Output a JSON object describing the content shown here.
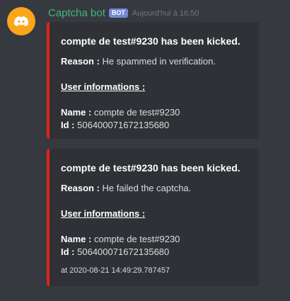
{
  "message": {
    "username": "Captcha bot",
    "bot_tag": "BOT",
    "timestamp": "Aujourd'hui à 16:50",
    "avatar_icon": "discord-logo-icon",
    "colors": {
      "username": "#43b581",
      "bot_tag": "#7289da",
      "avatar": "#faa61a",
      "embed_border": "#e0241b"
    }
  },
  "embeds": [
    {
      "title": "compte de test#9230 has been kicked.",
      "reason_label": "Reason :",
      "reason_value": "He spammed in verification.",
      "section_heading": "User informations :",
      "name_label": "Name :",
      "name_value": "compte de test#9230",
      "id_label": "Id :",
      "id_value": "506400071672135680"
    },
    {
      "title": "compte de test#9230 has been kicked.",
      "reason_label": "Reason :",
      "reason_value": "He failed the captcha.",
      "section_heading": "User informations :",
      "name_label": "Name :",
      "name_value": "compte de test#9230",
      "id_label": "Id :",
      "id_value": "506400071672135680",
      "footer": "at 2020-08-21 14:49:29.787457"
    }
  ]
}
